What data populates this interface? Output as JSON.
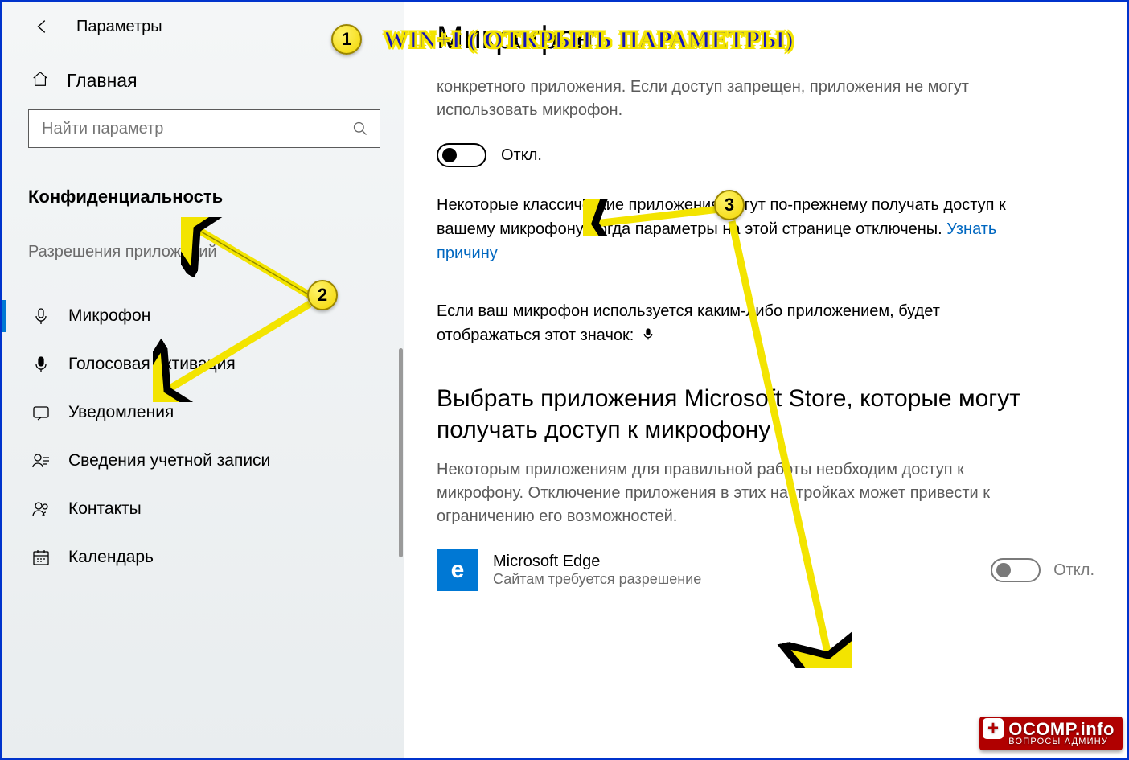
{
  "header": {
    "app_title": "Параметры"
  },
  "sidebar": {
    "home": "Главная",
    "search_placeholder": "Найти параметр",
    "section": "Конфиденциальность",
    "subsection": "Разрешения приложений",
    "items": [
      {
        "label": "Микрофон",
        "active": true
      },
      {
        "label": "Голосовая активация",
        "active": false
      },
      {
        "label": "Уведомления",
        "active": false
      },
      {
        "label": "Сведения учетной записи",
        "active": false
      },
      {
        "label": "Контакты",
        "active": false
      },
      {
        "label": "Календарь",
        "active": false
      }
    ]
  },
  "main": {
    "title": "Микрофон",
    "desc1": "конкретного приложения. Если доступ запрещен, приложения не могут использовать микрофон.",
    "toggle1_label": "Откл.",
    "block_text_1": "Некоторые классические приложения могут по-прежнему получать доступ к вашему микрофону, когда параметры на этой странице отключены. ",
    "learn_link": "Узнать причину",
    "block_text_2": "Если ваш микрофон используется каким-либо приложением, будет отображаться этот значок:",
    "sub_heading": "Выбрать приложения Microsoft Store, которые могут получать доступ к микрофону",
    "desc2": "Некоторым приложениям для правильной работы необходим доступ к микрофону. Отключение приложения в этих настройках может привести к ограничению его возможностей.",
    "app": {
      "name": "Microsoft Edge",
      "sub": "Сайтам требуется разрешение",
      "toggle_label": "Откл."
    }
  },
  "annotations": {
    "text": "WIN+I   ( ОТКРЫТЬ ПАРАМЕТРЫ)",
    "n1": "1",
    "n2": "2",
    "n3": "3"
  },
  "watermark": {
    "main": "OCOMP.info",
    "sub": "ВОПРОСЫ АДМИНУ"
  }
}
